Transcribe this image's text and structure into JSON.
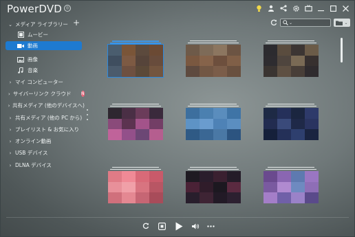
{
  "app": {
    "title": "PowerDVD"
  },
  "sidebar": {
    "library_label": "メディア ライブラリー",
    "library_items": [
      {
        "label": "ムービー",
        "icon": "movie-icon"
      },
      {
        "label": "動画",
        "icon": "video-icon",
        "active": true
      },
      {
        "label": "画像",
        "icon": "image-icon"
      },
      {
        "label": "音楽",
        "icon": "music-icon"
      }
    ],
    "sections": [
      {
        "label": "マイ コンピューター"
      },
      {
        "label": "サイバーリンク クラウド",
        "badge": "N"
      },
      {
        "label": "共有メディア (他のデバイスへ)"
      },
      {
        "label": "共有メディア (他の PC から)"
      },
      {
        "label": "プレイリスト & お気に入り"
      },
      {
        "label": "オンライン動画"
      },
      {
        "label": "USB デバイス"
      },
      {
        "label": "DLNA デバイス"
      }
    ]
  },
  "toolbar": {
    "search_placeholder": ""
  },
  "thumbnails": [
    {
      "caption": "",
      "selected": true,
      "colors": [
        "#4a5d6e",
        "#7a5538",
        "#5c4a3d",
        "#6b4a34",
        "#3f4e5f",
        "#7d5a43",
        "#56443a",
        "#684c3c",
        "#4b5b6c",
        "#6e5040",
        "#5b4938",
        "#73553f"
      ]
    },
    {
      "caption": "",
      "selected": false,
      "colors": [
        "#6e5a49",
        "#7e6b58",
        "#8c7660",
        "#6c5443",
        "#7a5840",
        "#86634a",
        "#6d4f3d",
        "#805f47",
        "#5e4a3f",
        "#725744",
        "#7b5d49",
        "#69503f"
      ]
    },
    {
      "caption": "",
      "selected": false,
      "colors": [
        "#2c2b2f",
        "#5a4c3e",
        "#3c3533",
        "#6b5b48",
        "#2e2c30",
        "#4f453e",
        "#7a6a55",
        "#37302f",
        "#3a3431",
        "#5e5043",
        "#483e38",
        "#2f2b2e"
      ]
    },
    {
      "caption": "",
      "selected": false,
      "colors": [
        "#2e2730",
        "#4a2f45",
        "#6b3c5a",
        "#3a2a3c",
        "#8a4a7a",
        "#5c3350",
        "#a3538a",
        "#733e66",
        "#c0639a",
        "#93508a",
        "#6c4775",
        "#b55e8f"
      ]
    },
    {
      "caption": "",
      "selected": false,
      "colors": [
        "#3d6f9e",
        "#4b80b0",
        "#5a8dbd",
        "#3f74a6",
        "#5e93c5",
        "#6a9cce",
        "#4e82b6",
        "#5b8ec0",
        "#2f5a85",
        "#3a6794",
        "#4a78a5",
        "#2c5480"
      ]
    },
    {
      "caption": "",
      "selected": false,
      "colors": [
        "#1e2a45",
        "#25305a",
        "#1b2640",
        "#2e3a6a",
        "#222c50",
        "#3a4a7a",
        "#1f2948",
        "#2a3460",
        "#15203a",
        "#243058",
        "#2e3f6e",
        "#1a2440"
      ]
    },
    {
      "caption": "",
      "selected": false,
      "colors": [
        "#e07b86",
        "#f08a96",
        "#d96a78",
        "#c95a6a",
        "#e8909a",
        "#f0a0a8",
        "#d87480",
        "#b85664",
        "#d0707c",
        "#e48892",
        "#c66674",
        "#a84c5a"
      ]
    },
    {
      "caption": "",
      "selected": false,
      "colors": [
        "#1e1a22",
        "#2a1d2c",
        "#3a2030",
        "#241c28",
        "#4a2236",
        "#301c2a",
        "#1c1820",
        "#5a2a40",
        "#281e2c",
        "#3e2434",
        "#221a26",
        "#2c2030"
      ]
    },
    {
      "caption": "",
      "selected": false,
      "colors": [
        "#6a4a8e",
        "#8a66b2",
        "#5e7ab0",
        "#9a76c2",
        "#7a5aa0",
        "#b08ad0",
        "#6e8ac0",
        "#8e6eb6",
        "#a47ec8",
        "#7060a8",
        "#9a82c8",
        "#5a4a8a"
      ]
    }
  ],
  "player": {
    "controls": [
      "repeat-icon",
      "stop-icon",
      "play-icon",
      "volume-icon",
      "more-icon"
    ]
  }
}
